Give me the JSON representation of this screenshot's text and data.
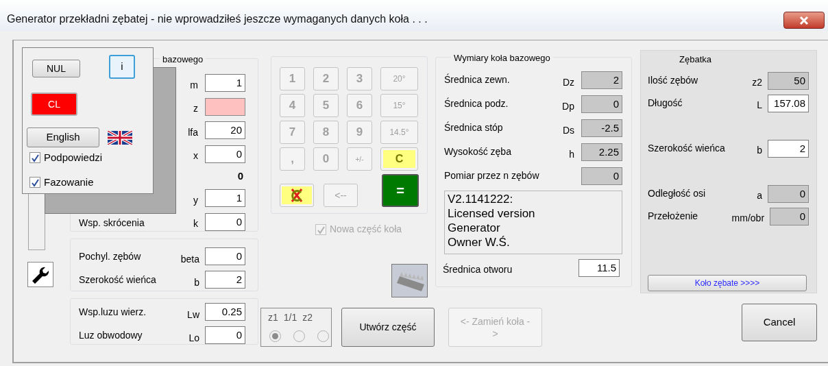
{
  "window": {
    "title": "Generator przekładni zębatej  -  nie wprowadziłeś jeszcze wymaganych danych koła . . ."
  },
  "popup": {
    "buttons": [
      {
        "label": "NUL",
        "kind": "plain"
      },
      {
        "label": "i",
        "kind": "focused"
      },
      {
        "label": "CL",
        "kind": "alert"
      }
    ],
    "language_button": "English",
    "checkboxes": [
      {
        "label": "Podpowiedzi",
        "checked": true
      },
      {
        "label": "Fazowanie",
        "checked": true
      }
    ]
  },
  "base_group": {
    "title": "bazowego",
    "rows": [
      {
        "kind": "input",
        "symbol": "m",
        "value": "1",
        "invalid": false
      },
      {
        "kind": "input",
        "symbol": "z",
        "invalid": true
      },
      {
        "kind": "input",
        "symbol": "lfa",
        "value": "20",
        "invalid": false
      },
      {
        "kind": "input",
        "symbol": "x",
        "value": "0",
        "invalid": false
      },
      {
        "kind": "readout",
        "value": "0"
      },
      {
        "kind": "input",
        "symbol": "y",
        "value": "1",
        "invalid": false
      },
      {
        "kind": "input",
        "label": "Wsp. skrócenia",
        "symbol": "k",
        "value": "0",
        "invalid": false
      }
    ]
  },
  "helix_group": {
    "rows": [
      {
        "label": "Pochyl. zębów",
        "symbol": "beta",
        "value": "0"
      },
      {
        "label": "Szerokość wieńca",
        "symbol": "b",
        "value": "2"
      }
    ]
  },
  "clearance_group": {
    "rows": [
      {
        "label": "Wsp.luzu wierz.",
        "symbol": "Lw",
        "value": "0.25"
      },
      {
        "label": "Luz obwodowy",
        "symbol": "Lo",
        "value": "0"
      }
    ]
  },
  "keypad": {
    "keys": [
      {
        "kind": "digit",
        "label": "1"
      },
      {
        "kind": "digit",
        "label": "2"
      },
      {
        "kind": "digit",
        "label": "3"
      },
      {
        "kind": "angle",
        "label": "20°"
      },
      {
        "kind": "digit",
        "label": "4"
      },
      {
        "kind": "digit",
        "label": "5"
      },
      {
        "kind": "digit",
        "label": "6"
      },
      {
        "kind": "angle",
        "label": "15°"
      },
      {
        "kind": "digit",
        "label": "7"
      },
      {
        "kind": "digit",
        "label": "8"
      },
      {
        "kind": "digit",
        "label": "9"
      },
      {
        "kind": "angle",
        "label": "14.5°"
      },
      {
        "kind": "digit",
        "label": ","
      },
      {
        "kind": "digit",
        "label": "0"
      },
      {
        "kind": "small",
        "label": "+/-"
      },
      {
        "kind": "clear",
        "label": "C"
      },
      {
        "kind": "clear_all"
      },
      {
        "kind": "back",
        "label": "<--"
      },
      {
        "kind": "equals",
        "label": "="
      }
    ]
  },
  "new_part_checkbox": {
    "label": "Nowa część koła",
    "checked": true,
    "disabled": true
  },
  "ratio": {
    "options": [
      {
        "label": "z1",
        "selected": true
      },
      {
        "label": "1/1",
        "selected": false
      },
      {
        "label": "z2",
        "selected": false
      }
    ]
  },
  "create_button": {
    "label": "Utwórz część",
    "disabled": false
  },
  "swap_button": {
    "label": "<- Zamień koła ->",
    "disabled": true
  },
  "dimensions": {
    "title": "Wymiary koła bazowego",
    "rows": [
      {
        "label": "Średnica zewn.",
        "symbol": "Dz",
        "value": "2"
      },
      {
        "label": "Średnica podz.",
        "symbol": "Dp",
        "value": "0"
      },
      {
        "label": "Średnica stóp",
        "symbol": "Ds",
        "value": "-2.5"
      },
      {
        "label": "Wysokość zęba",
        "symbol": "h",
        "value": "2.25"
      },
      {
        "label": "Pomiar przez n zębów",
        "value": "0"
      }
    ],
    "info_lines": [
      "V2.1141222:",
      "Licensed version",
      "Generator",
      "Owner W.Ś."
    ],
    "bore": {
      "label": "Średnica otworu",
      "value": "11.5"
    }
  },
  "rack": {
    "title": "Zębatka",
    "rows": [
      {
        "label": "Ilość zębów",
        "symbol": "z2",
        "value": "50",
        "kind": "readonly"
      },
      {
        "label": "Długość",
        "symbol": "L",
        "value": "157.08",
        "kind": "input"
      },
      {
        "kind": "spacer"
      },
      {
        "label": "Szerokość wieńca",
        "symbol": "b",
        "value": "2",
        "kind": "input"
      },
      {
        "kind": "spacer"
      },
      {
        "label": "Odległość osi",
        "symbol": "a",
        "value": "0",
        "kind": "readonly"
      },
      {
        "label": "Przełożenie",
        "symbol": "mm/obr",
        "value": "0",
        "kind": "readonly"
      }
    ],
    "button": "Koło zębate >>>>"
  },
  "cancel_button": "Cancel"
}
